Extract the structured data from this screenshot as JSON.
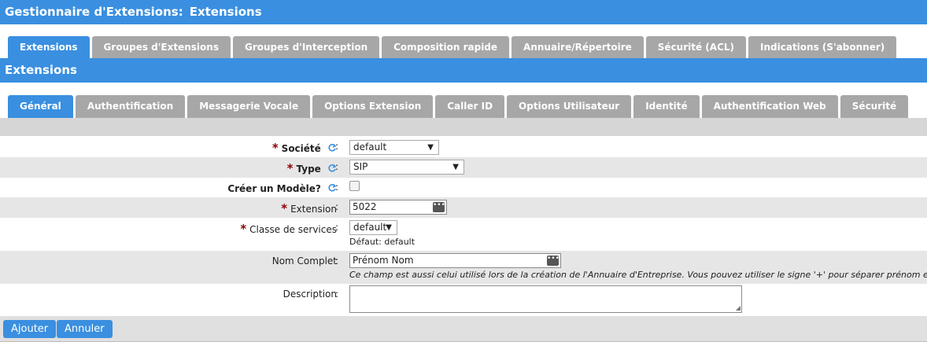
{
  "header": {
    "title_part1": "Gestionnaire d'Extensions:",
    "title_part2": "Extensions"
  },
  "main_tabs": [
    {
      "label": "Extensions",
      "active": true
    },
    {
      "label": "Groupes d'Extensions"
    },
    {
      "label": "Groupes d'Interception"
    },
    {
      "label": "Composition rapide"
    },
    {
      "label": "Annuaire/Répertoire"
    },
    {
      "label": "Sécurité (ACL)"
    },
    {
      "label": "Indications (S'abonner)"
    }
  ],
  "section": {
    "title": "Extensions"
  },
  "sub_tabs": [
    {
      "label": "Général",
      "active": true
    },
    {
      "label": "Authentification"
    },
    {
      "label": "Messagerie Vocale"
    },
    {
      "label": "Options Extension"
    },
    {
      "label": "Caller ID"
    },
    {
      "label": "Options Utilisateur"
    },
    {
      "label": "Identité"
    },
    {
      "label": "Authentification Web"
    },
    {
      "label": "Sécurité"
    }
  ],
  "form": {
    "societe": {
      "label": "Société",
      "value": "default"
    },
    "type": {
      "label": "Type",
      "value": "SIP"
    },
    "modele": {
      "label": "Créer un Modèle?"
    },
    "extension": {
      "label": "Extension",
      "value": "5022"
    },
    "classe": {
      "label": "Classe de services",
      "value": "default",
      "help": "Défaut: default"
    },
    "nom": {
      "label": "Nom Complet",
      "value": "Prénom Nom",
      "help": "Ce champ est aussi celui utilisé lors de la création de l'Annuaire d'Entreprise. Vous pouvez utiliser le signe '+' pour séparer prénom et nom."
    },
    "description": {
      "label": "Description",
      "value": ""
    },
    "required_mark": "*",
    "colon": ":"
  },
  "buttons": {
    "ajouter": "Ajouter",
    "annuler": "Annuler"
  },
  "colors": {
    "accent": "#3a8fe0",
    "tab_inactive": "#a7a7a7",
    "required": "#8b0000"
  }
}
